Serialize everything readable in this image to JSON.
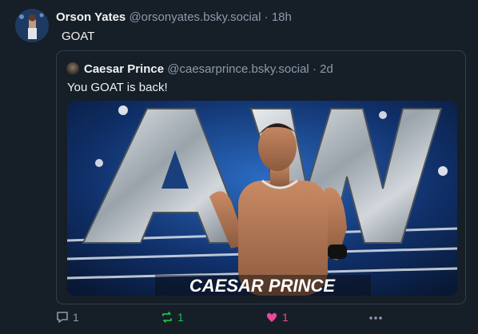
{
  "post": {
    "author_name": "Orson Yates",
    "author_handle": "@orsonyates.bsky.social",
    "separator": "·",
    "time": "18h",
    "text": "GOAT"
  },
  "quote": {
    "author_name": "Caesar Prince",
    "author_handle": "@caesarprince.bsky.social",
    "separator": "·",
    "time": "2d",
    "text": "You GOAT is back!",
    "image": {
      "logo_text": "AW",
      "caption": "CAESAR PRINCE"
    }
  },
  "actions": {
    "reply_count": "1",
    "repost_count": "1",
    "like_count": "1"
  },
  "colors": {
    "background": "#161e27",
    "text": "#f1f3f5",
    "muted": "#8c9bac",
    "repost": "#20bc4e",
    "like": "#ec4899"
  }
}
